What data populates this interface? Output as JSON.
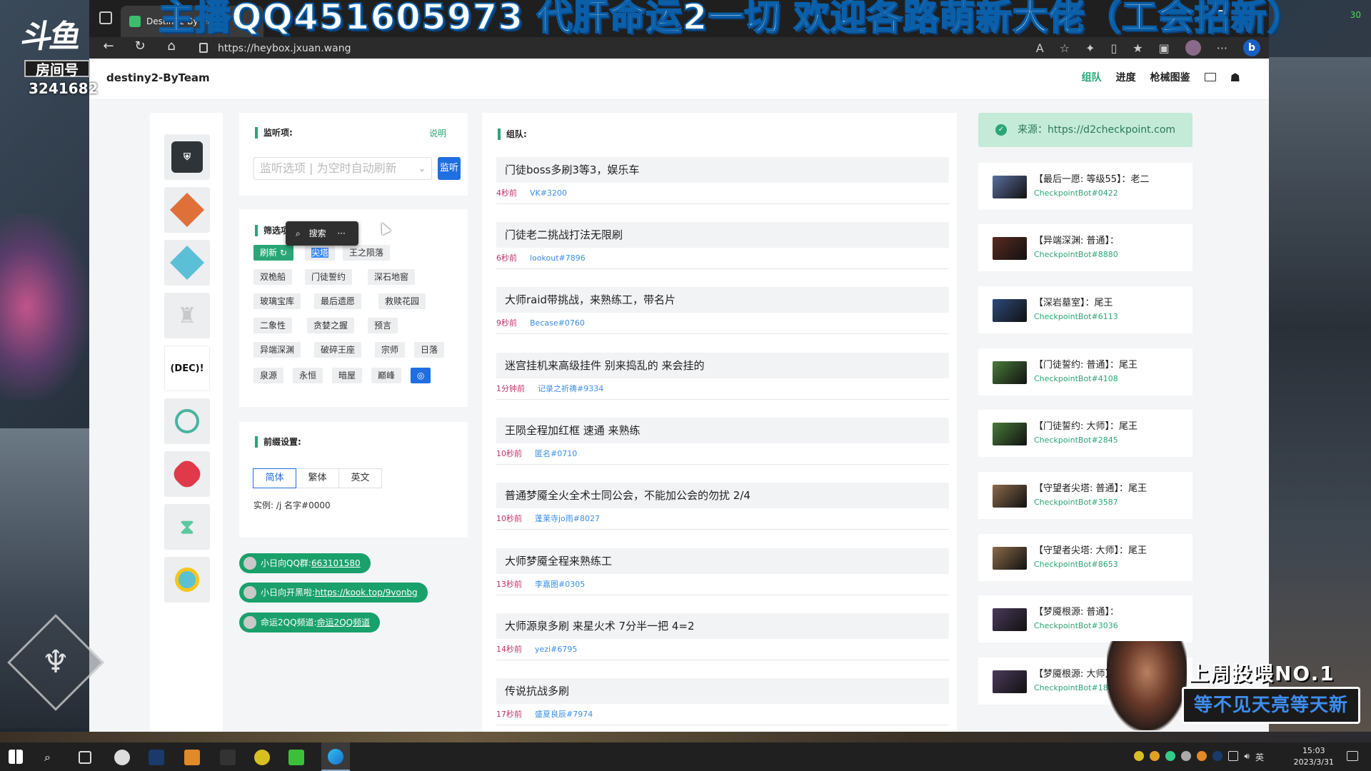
{
  "overlay": {
    "banner": "主播QQ451605973 代肝命运2一切 欢迎各路萌新大佬（工会招新）",
    "douyu_logo": "斗鱼",
    "room_label": "房间号",
    "room_number": "3241682",
    "corner_number": "30",
    "badge_top": "上周投喂NO.1",
    "badge_bottom": "等不见天亮等天新"
  },
  "browser": {
    "tab_title": "Destiny2-ByTeam",
    "url": "https://heybox.jxuan.wang"
  },
  "site": {
    "title": "destiny2-ByTeam",
    "nav": [
      "组队",
      "进度",
      "枪械图鉴"
    ]
  },
  "icons": [
    "ghost-shell-icon",
    "orange-diamond-icon",
    "blue-diamond-icon",
    "grey-emblem-icon",
    "dec-logo-icon",
    "teal-round-icon",
    "red-diamond-icon",
    "hourglass-icon",
    "yellow-diamond-icon"
  ],
  "icon_dec_text": "(DEC)!",
  "monitor": {
    "title": "监听项:",
    "help": "说明",
    "placeholder": "监听选项 | 为空时自动刷新",
    "button": "监听"
  },
  "filter": {
    "title": "筛选项:",
    "refresh": "刷新",
    "chips": [
      "尖塔",
      "王之陨落",
      "双桅船",
      "门徒誓约",
      "深石地窖",
      "玻璃宝库",
      "最后遗愿",
      "救赎花园",
      "二象性",
      "贪婪之握",
      "预言",
      "异端深渊",
      "破碎王座",
      "宗师",
      "日落",
      "泉源",
      "永恒",
      "暗屋",
      "巅峰"
    ]
  },
  "popup": {
    "search": "搜索",
    "more": "···"
  },
  "prefix": {
    "title": "前缀设置:",
    "options": [
      "简体",
      "繁体",
      "英文"
    ],
    "example": "实例: /j 名字#0000"
  },
  "links": [
    {
      "label": "小日向QQ群:",
      "value": "663101580"
    },
    {
      "label": "小日向开黑啦:",
      "value": "https://kook.top/9vonbg"
    },
    {
      "label": "命运2QQ频道:",
      "value": "命运2QQ频道"
    }
  ],
  "team": {
    "title": "组队:",
    "posts": [
      {
        "text": "门徒boss多刷3等3，娱乐车",
        "time": "4秒前",
        "user": "VK#3200"
      },
      {
        "text": "门徒老二挑战打法无限刷",
        "time": "6秒前",
        "user": "lookout#7896"
      },
      {
        "text": "大师raid带挑战，来熟练工，带名片",
        "time": "9秒前",
        "user": "Becase#0760"
      },
      {
        "text": "迷宫挂机来高级挂件 别来捣乱的 来会挂的",
        "time": "1分钟前",
        "user": "记录之祈祷#9334"
      },
      {
        "text": "王陨全程加红框 速通 来熟练",
        "time": "10秒前",
        "user": "匿名#0710"
      },
      {
        "text": "普通梦魇全火全术士同公会，不能加公会的勿扰 2/4",
        "time": "10秒前",
        "user": "蓬莱寺jo雨#8027"
      },
      {
        "text": "大师梦魇全程来熟练工",
        "time": "13秒前",
        "user": "李嘉图#0305"
      },
      {
        "text": "大师源泉多刷 来星火术 7分半一把 4=2",
        "time": "14秒前",
        "user": "yezi#6795"
      },
      {
        "text": "传说抗战多刷",
        "time": "17秒前",
        "user": "盛夏良辰#7974"
      }
    ]
  },
  "source": {
    "label": "来源：https://d2checkpoint.com"
  },
  "checkpoints": [
    {
      "name": "【最后一愿: 等级55】：老二",
      "bot": "CheckpointBot#0422",
      "color": "#5a6f9e"
    },
    {
      "name": "【异端深渊: 普通】：",
      "bot": "CheckpointBot#8880",
      "color": "#5a2a20"
    },
    {
      "name": "【深岩墓室】：尾王",
      "bot": "CheckpointBot#6113",
      "color": "#2e4a7a"
    },
    {
      "name": "【门徒誓约: 普通】：尾王",
      "bot": "CheckpointBot#4108",
      "color": "#4a7a3a"
    },
    {
      "name": "【门徒誓约: 大师】：尾王",
      "bot": "CheckpointBot#2845",
      "color": "#4a7a3a"
    },
    {
      "name": "【守望者尖塔: 普通】：尾王",
      "bot": "CheckpointBot#3587",
      "color": "#8a6a4a"
    },
    {
      "name": "【守望者尖塔: 大师】：尾王",
      "bot": "CheckpointBot#8653",
      "color": "#8a6a4a"
    },
    {
      "name": "【梦魇根源: 普通】：",
      "bot": "CheckpointBot#3036",
      "color": "#4a3a5a"
    },
    {
      "name": "【梦魇根源: 大师】：",
      "bot": "CheckpointBot#1883",
      "color": "#4a3a5a"
    }
  ],
  "taskbar": {
    "ime": "英",
    "time": "15:03",
    "date": "2023/3/31"
  }
}
